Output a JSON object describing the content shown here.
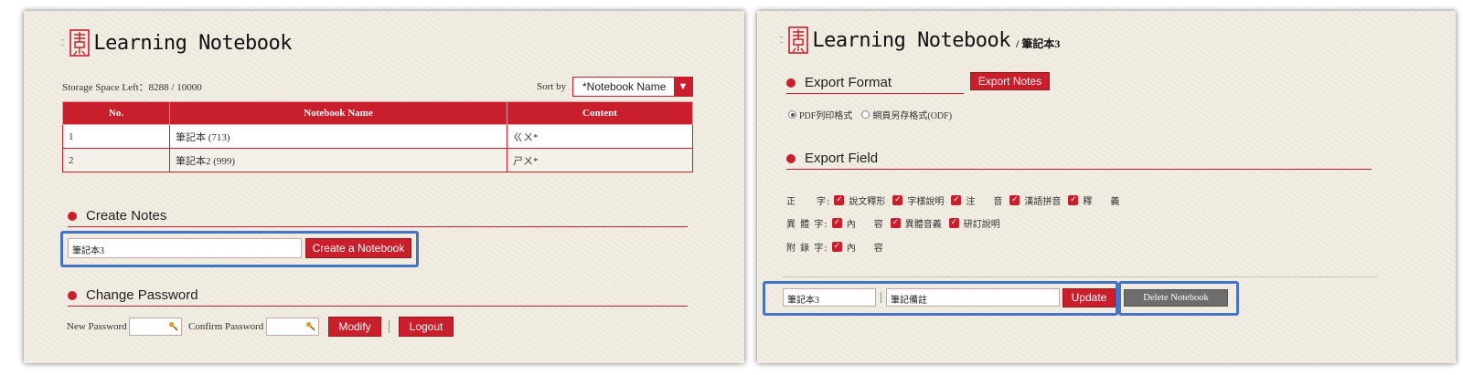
{
  "app": {
    "title": "Learning Notebook",
    "breadcrumb": "/ 筆記本3",
    "dots": "⁚⁚"
  },
  "colors": {
    "accent": "#c91f2c",
    "highlight": "#4472c4",
    "panel_bg": "#f1ede2"
  },
  "left": {
    "storage": "Storage Space Left：8288 / 10000",
    "sort_label": "Sort by",
    "sort_value": "*Notebook Name",
    "sort_arrow": "▼",
    "table": {
      "headers": [
        "No.",
        "Notebook Name",
        "Content"
      ],
      "rows": [
        {
          "no": "1",
          "name": "筆記本 (713)",
          "content": "ㄍㄨ*"
        },
        {
          "no": "2",
          "name": "筆記本2 (999)",
          "content": "ㄕㄨ*"
        }
      ]
    },
    "create": {
      "title": "Create Notes",
      "input_value": "筆記本3",
      "button": "Create a Notebook"
    },
    "password": {
      "title": "Change Password",
      "new_label": "New Password",
      "confirm_label": "Confirm Password",
      "modify": "Modify",
      "logout": "Logout",
      "key_icon": "key-icon"
    }
  },
  "right": {
    "export_format": {
      "title": "Export Format",
      "button": "Export Notes",
      "options": [
        {
          "label": "PDF列印格式",
          "selected": true
        },
        {
          "label": "網頁另存格式(ODF)",
          "selected": false
        }
      ]
    },
    "export_field": {
      "title": "Export Field",
      "check": "✓",
      "rows": [
        {
          "label": "正　　字:",
          "items": [
            "說文釋形",
            "字樣說明",
            "注　　音",
            "漢語拼音",
            "釋　　義"
          ]
        },
        {
          "label": "異 體 字:",
          "items": [
            "內　　容",
            "異體音義",
            "研訂說明"
          ]
        },
        {
          "label": "附 錄 字:",
          "items": [
            "內　　容"
          ]
        }
      ]
    },
    "edit": {
      "name_value": "筆記本3",
      "note_value": "筆記備註",
      "update": "Update",
      "delete": "Delete Notebook"
    }
  }
}
